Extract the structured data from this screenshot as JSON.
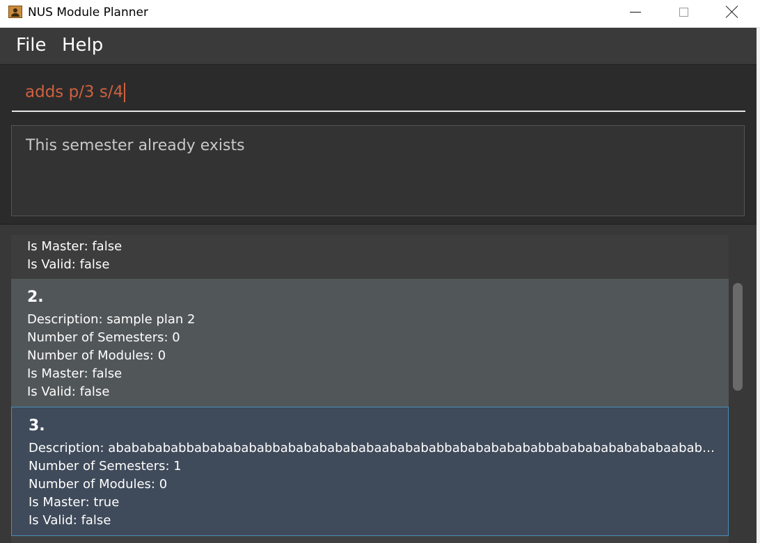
{
  "window": {
    "title": "NUS Module Planner",
    "icon": "app-icon"
  },
  "menu": {
    "file": "File",
    "help": "Help"
  },
  "command": {
    "value": "adds p/3 s/4"
  },
  "result": {
    "message": "This semester already exists"
  },
  "plans": [
    {
      "number": "",
      "is_master": "Is Master: false",
      "is_valid": "Is Valid: false"
    },
    {
      "number": "2.",
      "description": "Description: sample plan 2",
      "semesters": "Number of Semesters: 0",
      "modules": "Number of Modules: 0",
      "is_master": "Is Master: false",
      "is_valid": "Is Valid: false"
    },
    {
      "number": "3.",
      "description": "Description: abababababbabababababbababababababaababababbababababababbabababababababaababababbab...",
      "semesters": "Number of Semesters: 1",
      "modules": "Number of Modules: 0",
      "is_master": "Is Master: true",
      "is_valid": "Is Valid: false"
    }
  ],
  "colors": {
    "command_text": "#d0603f",
    "selected_border": "#4a8fb8",
    "selected_bg": "#3f4a5a"
  }
}
